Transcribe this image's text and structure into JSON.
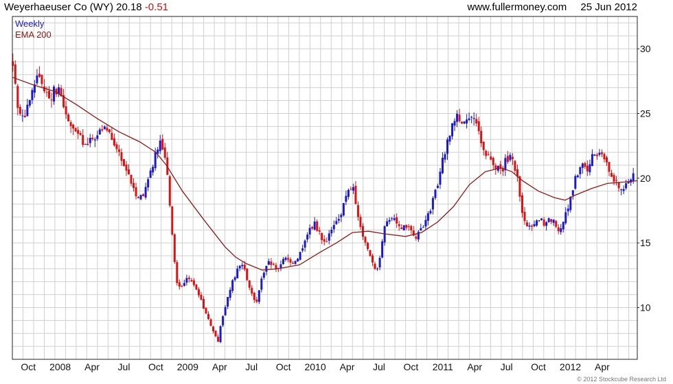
{
  "header": {
    "title_prefix": "Weyerhaeuser Co (WY) 20.18",
    "change": "-0.51",
    "website": "www.fullermoney.com",
    "date": "25 Jun 2012"
  },
  "legend": {
    "period": "Weekly",
    "ema_label": "EMA 200"
  },
  "copyright": "© 2012 Stockcube Research Ltd",
  "colors": {
    "up": "#1a1acc",
    "down": "#dd1111",
    "ema": "#8b1a1a",
    "legend_period": "#1a1acc",
    "legend_ema": "#8b1a1a"
  },
  "chart_data": {
    "type": "candlestick",
    "y_axis_position": "right",
    "ylim": [
      6,
      32.5
    ],
    "y_ticks": [
      10,
      15,
      20,
      25,
      30
    ],
    "grid": true,
    "x_ticks": [
      {
        "label": "Oct",
        "pos": 1.5
      },
      {
        "label": "2008",
        "pos": 4.5
      },
      {
        "label": "Apr",
        "pos": 7.5
      },
      {
        "label": "Jul",
        "pos": 10.5
      },
      {
        "label": "Oct",
        "pos": 13.5
      },
      {
        "label": "2009",
        "pos": 16.5
      },
      {
        "label": "Apr",
        "pos": 19.5
      },
      {
        "label": "Jul",
        "pos": 22.5
      },
      {
        "label": "Oct",
        "pos": 25.5
      },
      {
        "label": "2010",
        "pos": 28.5
      },
      {
        "label": "Apr",
        "pos": 31.5
      },
      {
        "label": "Jul",
        "pos": 34.5
      },
      {
        "label": "Oct",
        "pos": 37.5
      },
      {
        "label": "2011",
        "pos": 40.5
      },
      {
        "label": "Apr",
        "pos": 43.5
      },
      {
        "label": "Jul",
        "pos": 46.5
      },
      {
        "label": "Oct",
        "pos": 49.5
      },
      {
        "label": "2012",
        "pos": 52.5
      },
      {
        "label": "Apr",
        "pos": 55.5
      }
    ],
    "x_range": [
      0,
      58.8
    ],
    "price": [
      [
        0.0,
        29
      ],
      [
        0.3,
        27
      ],
      [
        0.6,
        25
      ],
      [
        1.0,
        24.5
      ],
      [
        1.5,
        25.5
      ],
      [
        2.0,
        27
      ],
      [
        2.5,
        28
      ],
      [
        3.0,
        27
      ],
      [
        3.5,
        26
      ],
      [
        4.0,
        27
      ],
      [
        4.5,
        26.5
      ],
      [
        5.0,
        25
      ],
      [
        5.5,
        24
      ],
      [
        6.0,
        23.5
      ],
      [
        6.5,
        23
      ],
      [
        7.0,
        22.5
      ],
      [
        7.5,
        23
      ],
      [
        8.0,
        23.5
      ],
      [
        8.5,
        23.5
      ],
      [
        9.0,
        24
      ],
      [
        9.5,
        23
      ],
      [
        10.0,
        22
      ],
      [
        10.5,
        21
      ],
      [
        11.0,
        20
      ],
      [
        11.5,
        19
      ],
      [
        12.0,
        18.5
      ],
      [
        12.5,
        19
      ],
      [
        13.0,
        20.5
      ],
      [
        13.5,
        22
      ],
      [
        14.0,
        23
      ],
      [
        14.5,
        21
      ],
      [
        14.8,
        18
      ],
      [
        15.0,
        16
      ],
      [
        15.2,
        14
      ],
      [
        15.5,
        12
      ],
      [
        16.0,
        11.5
      ],
      [
        16.5,
        12.5
      ],
      [
        17.0,
        12
      ],
      [
        17.5,
        11
      ],
      [
        18.0,
        10
      ],
      [
        18.5,
        9
      ],
      [
        19.0,
        8
      ],
      [
        19.3,
        7.2
      ],
      [
        19.6,
        8.5
      ],
      [
        20.0,
        10
      ],
      [
        20.5,
        11.5
      ],
      [
        21.0,
        12.5
      ],
      [
        21.5,
        13.5
      ],
      [
        22.0,
        12.5
      ],
      [
        22.5,
        11
      ],
      [
        23.0,
        10.5
      ],
      [
        23.5,
        12.5
      ],
      [
        24.0,
        13.5
      ],
      [
        24.5,
        13.3
      ],
      [
        25.0,
        13
      ],
      [
        25.5,
        13.8
      ],
      [
        26.0,
        13.5
      ],
      [
        26.5,
        13.5
      ],
      [
        27.0,
        14
      ],
      [
        27.5,
        15
      ],
      [
        28.0,
        16
      ],
      [
        28.5,
        16.5
      ],
      [
        29.0,
        15.5
      ],
      [
        29.5,
        15
      ],
      [
        30.0,
        16
      ],
      [
        30.5,
        16.5
      ],
      [
        31.0,
        17.5
      ],
      [
        31.5,
        19
      ],
      [
        32.0,
        19.5
      ],
      [
        32.5,
        17
      ],
      [
        33.0,
        15.5
      ],
      [
        33.5,
        14.5
      ],
      [
        34.0,
        13
      ],
      [
        34.3,
        12.7
      ],
      [
        34.6,
        14
      ],
      [
        35.0,
        16
      ],
      [
        35.5,
        17
      ],
      [
        36.0,
        16.8
      ],
      [
        36.5,
        16.3
      ],
      [
        37.0,
        16.3
      ],
      [
        37.5,
        16
      ],
      [
        38.0,
        15.5
      ],
      [
        38.5,
        16
      ],
      [
        39.0,
        17
      ],
      [
        39.5,
        18
      ],
      [
        40.0,
        19.5
      ],
      [
        40.5,
        21.5
      ],
      [
        41.0,
        23
      ],
      [
        41.5,
        24.5
      ],
      [
        42.0,
        24.8
      ],
      [
        42.5,
        24
      ],
      [
        43.0,
        24.5
      ],
      [
        43.5,
        24.5
      ],
      [
        44.0,
        23
      ],
      [
        44.5,
        22
      ],
      [
        45.0,
        21.5
      ],
      [
        45.5,
        21
      ],
      [
        46.0,
        20.5
      ],
      [
        46.5,
        21.5
      ],
      [
        47.0,
        21.5
      ],
      [
        47.5,
        20
      ],
      [
        48.0,
        17
      ],
      [
        48.5,
        16
      ],
      [
        49.0,
        16.5
      ],
      [
        49.5,
        17
      ],
      [
        50.0,
        16.5
      ],
      [
        50.5,
        17
      ],
      [
        51.0,
        16.5
      ],
      [
        51.5,
        16
      ],
      [
        52.0,
        17
      ],
      [
        52.5,
        18.5
      ],
      [
        53.0,
        20
      ],
      [
        53.5,
        21
      ],
      [
        54.0,
        20.5
      ],
      [
        54.5,
        21.5
      ],
      [
        55.0,
        22
      ],
      [
        55.5,
        22
      ],
      [
        56.0,
        21
      ],
      [
        56.5,
        20
      ],
      [
        57.0,
        19.5
      ],
      [
        57.5,
        19
      ],
      [
        58.0,
        20
      ],
      [
        58.5,
        20.2
      ]
    ],
    "ema": [
      [
        0.0,
        27.8
      ],
      [
        2.0,
        27.2
      ],
      [
        4.0,
        26.7
      ],
      [
        6.0,
        25.7
      ],
      [
        8.0,
        24.6
      ],
      [
        10.0,
        23.6
      ],
      [
        12.0,
        22.8
      ],
      [
        13.5,
        22.0
      ],
      [
        14.5,
        21.0
      ],
      [
        16.0,
        19.0
      ],
      [
        18.0,
        16.8
      ],
      [
        20.0,
        14.7
      ],
      [
        21.0,
        13.9
      ],
      [
        22.0,
        13.4
      ],
      [
        23.5,
        12.9
      ],
      [
        25.0,
        13.0
      ],
      [
        27.0,
        13.3
      ],
      [
        29.0,
        14.3
      ],
      [
        30.5,
        15.0
      ],
      [
        32.0,
        15.8
      ],
      [
        33.5,
        15.9
      ],
      [
        35.0,
        15.7
      ],
      [
        37.0,
        15.5
      ],
      [
        38.5,
        15.8
      ],
      [
        40.0,
        16.6
      ],
      [
        41.5,
        17.8
      ],
      [
        43.0,
        19.5
      ],
      [
        44.5,
        20.5
      ],
      [
        46.0,
        20.8
      ],
      [
        47.0,
        20.5
      ],
      [
        48.0,
        19.8
      ],
      [
        49.5,
        19.0
      ],
      [
        51.0,
        18.5
      ],
      [
        52.0,
        18.3
      ],
      [
        53.0,
        18.7
      ],
      [
        54.5,
        19.2
      ],
      [
        56.0,
        19.6
      ],
      [
        57.5,
        19.7
      ],
      [
        58.8,
        19.8
      ]
    ]
  }
}
